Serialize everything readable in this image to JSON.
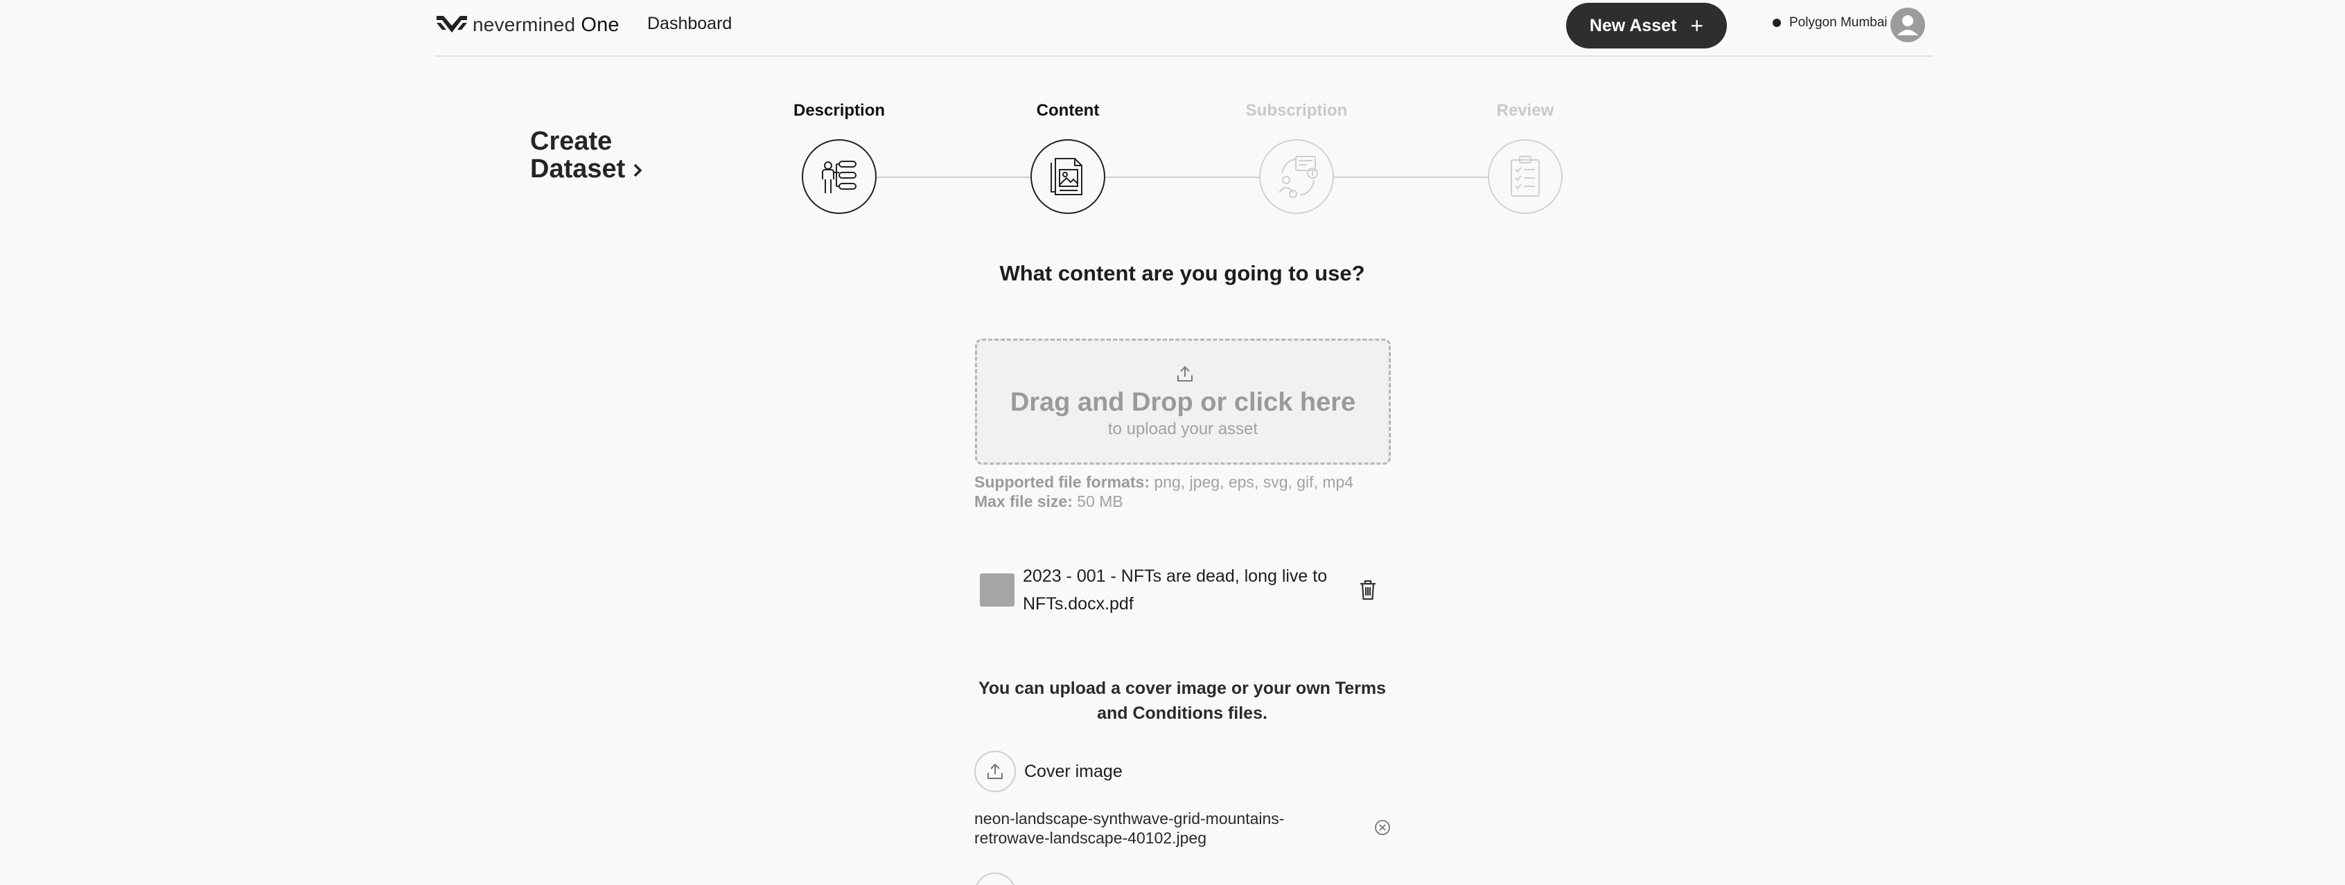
{
  "header": {
    "brand_name": "nevermined",
    "brand_suffix": "One",
    "nav_dashboard": "Dashboard",
    "new_asset_label": "New Asset",
    "network_label": "Polygon Mumbai"
  },
  "create": {
    "title_line1": "Create",
    "title_line2": "Dataset"
  },
  "steps": [
    {
      "label": "Description",
      "state": "completed",
      "icon": "description-icon"
    },
    {
      "label": "Content",
      "state": "active",
      "icon": "content-icon"
    },
    {
      "label": "Subscription",
      "state": "pending",
      "icon": "subscription-icon"
    },
    {
      "label": "Review",
      "state": "pending",
      "icon": "review-icon"
    }
  ],
  "content": {
    "question": "What content are you going to use?",
    "dropzone_title": "Drag and Drop or click here",
    "dropzone_subtitle": "to upload your asset",
    "formats_label": "Supported file formats:",
    "formats_value": "png, jpeg, eps, svg, gif, mp4",
    "max_size_label": "Max file size:",
    "max_size_value": "50 MB",
    "uploaded_file": "2023 - 001 - NFTs are dead, long live to NFTs.docx.pdf",
    "upload_hint": "You can upload a cover image or your own Terms and Conditions files.",
    "cover_label": "Cover image",
    "cover_file": "neon-landscape-synthwave-grid-mountains-retrowave-landscape-40102.jpeg"
  },
  "colors": {
    "primary_button": "#2e2e2e",
    "page_background": "#f9f9f9",
    "muted_text": "#a2a2a2"
  }
}
